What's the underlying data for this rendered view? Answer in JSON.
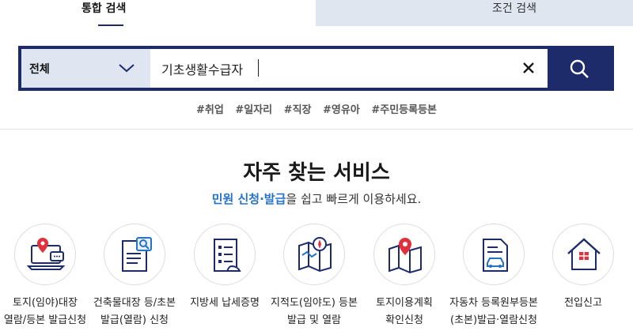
{
  "tabs": {
    "integrated": "통합 검색",
    "condition": "조건 검색"
  },
  "search": {
    "category": "전체",
    "query": "기초생활수급자"
  },
  "hashtags": [
    "#취업",
    "#일자리",
    "#직장",
    "#영유아",
    "#주민등록등본"
  ],
  "services_section": {
    "title": "자주 찾는 서비스",
    "subtitle_highlight": "민원 신청·발급",
    "subtitle_rest": "을 쉽고 빠르게 이용하세요."
  },
  "services": [
    {
      "line1": "토지(임야)대장",
      "line2": "열람/등본 발급신청",
      "icon": "land-register-laptop-icon"
    },
    {
      "line1": "건축물대장 등/초본",
      "line2": "발급(열람) 신청",
      "icon": "building-register-document-icon"
    },
    {
      "line1": "지방세 납세증명",
      "line2": "",
      "icon": "tax-certificate-icon"
    },
    {
      "line1": "지적도(임야도) 등본",
      "line2": "발급 및 열람",
      "icon": "cadastral-map-icon"
    },
    {
      "line1": "토지이용계획",
      "line2": "확인신청",
      "icon": "land-use-map-pin-icon"
    },
    {
      "line1": "자동차 등록원부등본",
      "line2": "(초본)발급·열람신청",
      "icon": "car-register-document-icon"
    },
    {
      "line1": "전입신고",
      "line2": "",
      "icon": "house-move-in-icon"
    }
  ],
  "colors": {
    "brand_navy": "#1d2b6b",
    "accent_blue": "#2572c6",
    "icon_red": "#e0313c",
    "tab_inactive_bg": "#dfe6f0"
  }
}
